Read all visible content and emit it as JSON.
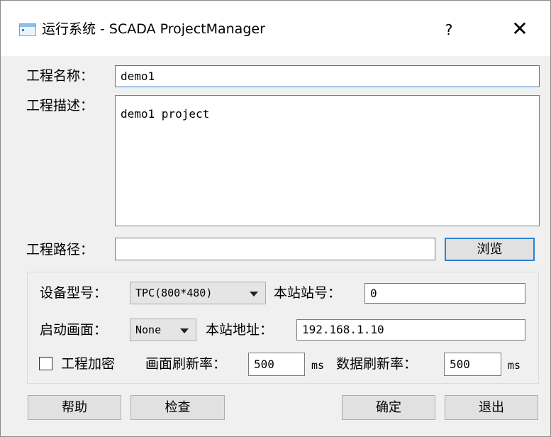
{
  "window": {
    "title": "运行系统 - SCADA ProjectManager",
    "help_label": "?",
    "close_label": "✕"
  },
  "project": {
    "name_label": "工程名称：",
    "name_value": "demo1",
    "desc_label": "工程描述：",
    "desc_value": "demo1 project",
    "path_label": "工程路径：",
    "path_value": "",
    "browse_label": "浏览"
  },
  "device": {
    "model_label": "设备型号：",
    "model_value": "TPC(800*480)",
    "station_no_label": "本站站号：",
    "station_no_value": "0",
    "start_screen_label": "启动画面：",
    "start_screen_value": "None",
    "station_addr_label": "本站地址：",
    "station_addr_value": "192.168.1.10",
    "encrypt_label": "工程加密",
    "encrypt_checked": false,
    "screen_refresh_label": "画面刷新率：",
    "screen_refresh_value": "500",
    "screen_refresh_unit": "ms",
    "data_refresh_label": "数据刷新率：",
    "data_refresh_value": "500",
    "data_refresh_unit": "ms"
  },
  "buttons": {
    "help": "帮助",
    "check": "检查",
    "ok": "确定",
    "exit": "退出"
  }
}
